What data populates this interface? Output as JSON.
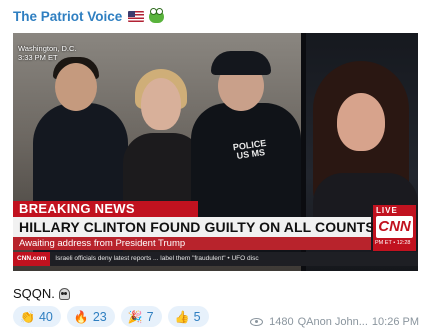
{
  "post": {
    "channel_name": "The Patriot Voice",
    "channel_emojis": [
      "us-flag-icon",
      "frog-icon"
    ],
    "caption_text": "SQQN.",
    "caption_emoji": "skull-icon",
    "views": "1480",
    "author": "QAnon John...",
    "time": "10:26 PM"
  },
  "media": {
    "location_line1": "Washington, D.C.",
    "location_line2": "3:33 PM ET",
    "police_patch": "POLICE US MS",
    "breaking_label": "BREAKING NEWS",
    "headline": "HILLARY CLINTON FOUND GUILTY ON ALL COUNTS",
    "subheadline": "Awaiting address from President Trump",
    "ticker_logo": "CNN.com",
    "ticker_text": "Israeli officials deny latest reports ... label them \"fraudulent\" • UFO disc",
    "live_label": "LIVE",
    "network_logo": "CNN",
    "live_time": "PM ET • 12:28"
  },
  "reactions": [
    {
      "emoji": "👏",
      "icon": "clap-icon",
      "count": "40"
    },
    {
      "emoji": "🔥",
      "icon": "fire-icon",
      "count": "23"
    },
    {
      "emoji": "🎉",
      "icon": "party-popper-icon",
      "count": "7"
    },
    {
      "emoji": "👍",
      "icon": "thumbs-up-icon",
      "count": "5"
    }
  ],
  "colors": {
    "channel_name": "#2f7fc1",
    "breaking_red": "#c1121f",
    "reaction_bg": "#e7f1fb",
    "meta_gray": "#8a959e"
  }
}
